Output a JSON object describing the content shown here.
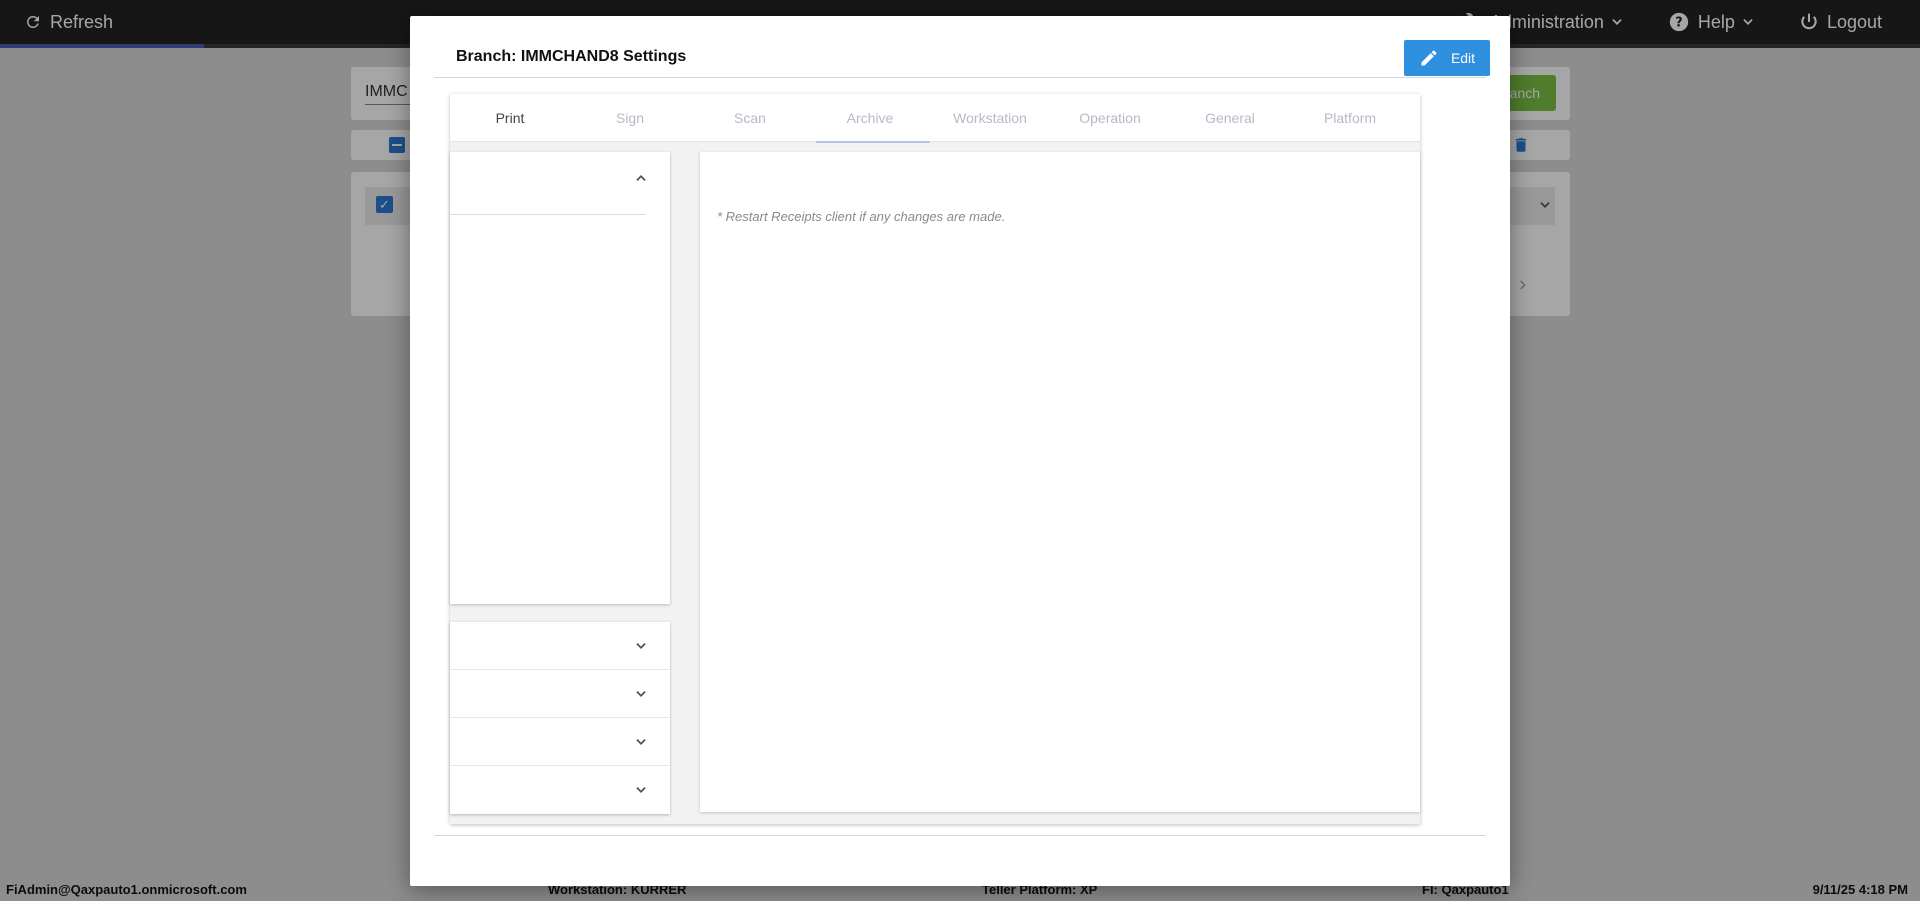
{
  "topbar": {
    "refresh_label": "Refresh",
    "progress_fraction": 0.106,
    "nav": {
      "administration_label": "Administration",
      "help_label": "Help",
      "logout_label": "Logout"
    }
  },
  "background": {
    "search_value": "IMMC",
    "add_branch_label": "anch"
  },
  "statusbar": {
    "user": "FiAdmin@Qaxpauto1.onmicrosoft.com",
    "workstation": "Workstation: KURRER",
    "teller_platform": "Teller Platform: XP",
    "fi": "FI: Qaxpauto1",
    "datetime": "9/11/25 4:18 PM"
  },
  "modal": {
    "title": "Branch: IMMCHAND8 Settings",
    "edit_label": "Edit",
    "tabs": [
      {
        "label": "Print"
      },
      {
        "label": "Sign"
      },
      {
        "label": "Scan"
      },
      {
        "label": "Archive"
      },
      {
        "label": "Workstation"
      },
      {
        "label": "Operation"
      },
      {
        "label": "General"
      },
      {
        "label": "Platform"
      }
    ],
    "active_tab": "Print",
    "notice": "* Restart Receipts client if any changes are made."
  },
  "colors": {
    "topbar": "#222222",
    "edit_button": "#2f8fdf",
    "add_branch_button": "#7ac142",
    "checkbox": "#2c7ad6",
    "tab_inactive": "#b7b9c8"
  }
}
